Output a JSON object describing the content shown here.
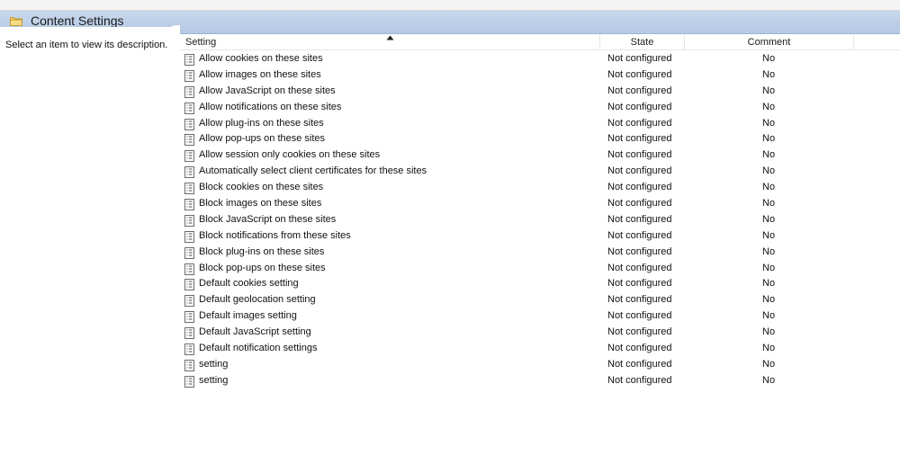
{
  "header": {
    "title": "Content Settings",
    "icon": "folder-icon"
  },
  "description": {
    "text": "Select an item to view its description."
  },
  "columns": {
    "setting": "Setting",
    "state": "State",
    "comment": "Comment"
  },
  "rows": [
    {
      "name": "Allow cookies on these sites",
      "state": "Not configured",
      "comment": "No"
    },
    {
      "name": "Allow images on these sites",
      "state": "Not configured",
      "comment": "No"
    },
    {
      "name": "Allow JavaScript on these sites",
      "state": "Not configured",
      "comment": "No"
    },
    {
      "name": "Allow notifications on these sites",
      "state": "Not configured",
      "comment": "No"
    },
    {
      "name": "Allow plug-ins on these sites",
      "state": "Not configured",
      "comment": "No"
    },
    {
      "name": "Allow pop-ups on these sites",
      "state": "Not configured",
      "comment": "No"
    },
    {
      "name": "Allow session only cookies on these sites",
      "state": "Not configured",
      "comment": "No"
    },
    {
      "name": "Automatically select client certificates for these sites",
      "state": "Not configured",
      "comment": "No"
    },
    {
      "name": "Block cookies on these sites",
      "state": "Not configured",
      "comment": "No"
    },
    {
      "name": "Block images on these sites",
      "state": "Not configured",
      "comment": "No"
    },
    {
      "name": "Block JavaScript on these sites",
      "state": "Not configured",
      "comment": "No"
    },
    {
      "name": "Block notifications from these sites",
      "state": "Not configured",
      "comment": "No"
    },
    {
      "name": "Block plug-ins on these sites",
      "state": "Not configured",
      "comment": "No"
    },
    {
      "name": "Block pop-ups on these sites",
      "state": "Not configured",
      "comment": "No"
    },
    {
      "name": "Default cookies setting",
      "state": "Not configured",
      "comment": "No"
    },
    {
      "name": "Default geolocation setting",
      "state": "Not configured",
      "comment": "No"
    },
    {
      "name": "Default images setting",
      "state": "Not configured",
      "comment": "No"
    },
    {
      "name": "Default JavaScript setting",
      "state": "Not configured",
      "comment": "No"
    },
    {
      "name": "Default notification settings",
      "state": "Not configured",
      "comment": "No"
    },
    {
      "name": "setting",
      "state": "Not configured",
      "comment": "No"
    },
    {
      "name": "setting",
      "state": "Not configured",
      "comment": "No"
    }
  ]
}
